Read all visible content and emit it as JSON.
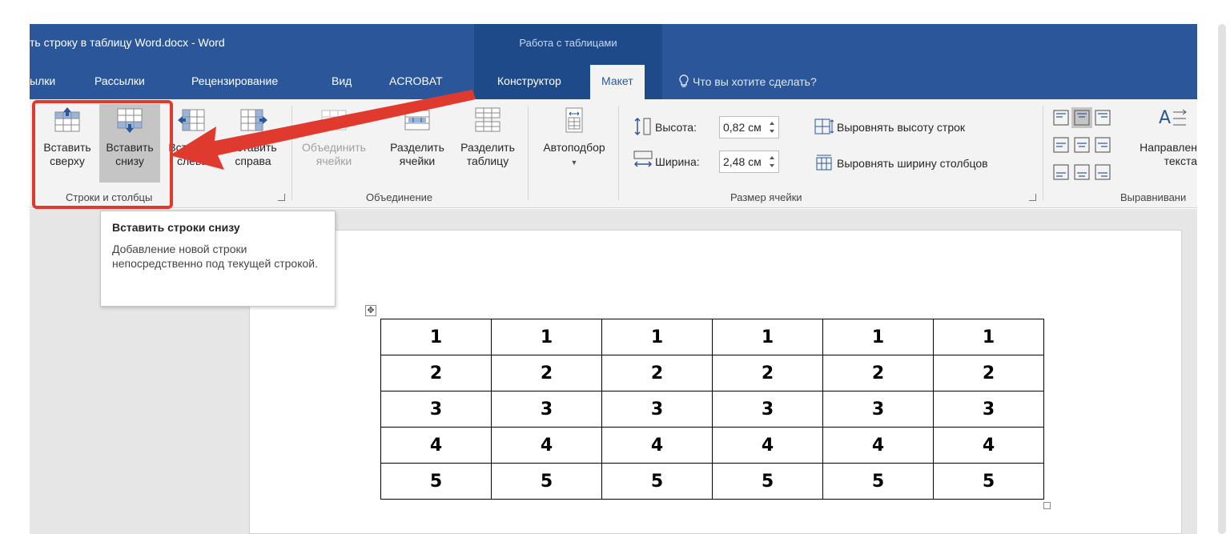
{
  "window": {
    "title": "ть строку в таблицу Word.docx - Word",
    "context_tab_group": "Работа с таблицами"
  },
  "tabs": [
    {
      "label": "ылки"
    },
    {
      "label": "Рассылки"
    },
    {
      "label": "Рецензирование"
    },
    {
      "label": "Вид"
    },
    {
      "label": "ACROBAT"
    },
    {
      "label": "Конструктор"
    },
    {
      "label": "Макет",
      "active": true
    }
  ],
  "tell_me": "Что вы хотите сделать?",
  "ribbon": {
    "rows_cols": {
      "insert_above": {
        "line1": "Вставить",
        "line2": "сверху"
      },
      "insert_below": {
        "line1": "Вставить",
        "line2": "снизу"
      },
      "insert_left": {
        "line1": "Вставить",
        "line2": "слева"
      },
      "insert_right": {
        "line1": "Вставить",
        "line2": "справа"
      },
      "label": "Строки и столбцы"
    },
    "merge": {
      "merge_cells": {
        "line1": "Объединить",
        "line2": "ячейки"
      },
      "split_cells": {
        "line1": "Разделить",
        "line2": "ячейки"
      },
      "split_table": {
        "line1": "Разделить",
        "line2": "таблицу"
      },
      "label": "Объединение"
    },
    "autofit": {
      "label": "Автоподбор"
    },
    "cell_size": {
      "height_label": "Высота:",
      "height_value": "0,82 см",
      "width_label": "Ширина:",
      "width_value": "2,48 см",
      "distribute_rows": "Выровнять высоту строк",
      "distribute_cols": "Выровнять ширину столбцов",
      "label": "Размер ячейки"
    },
    "alignment": {
      "text_direction": {
        "line1": "Направлен",
        "line2": "текста"
      },
      "label": "Выравнивани"
    }
  },
  "tooltip": {
    "title": "Вставить строки снизу",
    "body": "Добавление новой строки непосредственно под текущей строкой."
  },
  "table": {
    "rows": [
      [
        "1",
        "1",
        "1",
        "1",
        "1",
        "1"
      ],
      [
        "2",
        "2",
        "2",
        "2",
        "2",
        "2"
      ],
      [
        "3",
        "3",
        "3",
        "3",
        "3",
        "3"
      ],
      [
        "4",
        "4",
        "4",
        "4",
        "4",
        "4"
      ],
      [
        "5",
        "5",
        "5",
        "5",
        "5",
        "5"
      ]
    ]
  },
  "colors": {
    "title_bar": "#2b579a",
    "context_tab": "#1f4a8a",
    "ribbon": "#f3f3f3",
    "highlight": "#e03a2f"
  }
}
